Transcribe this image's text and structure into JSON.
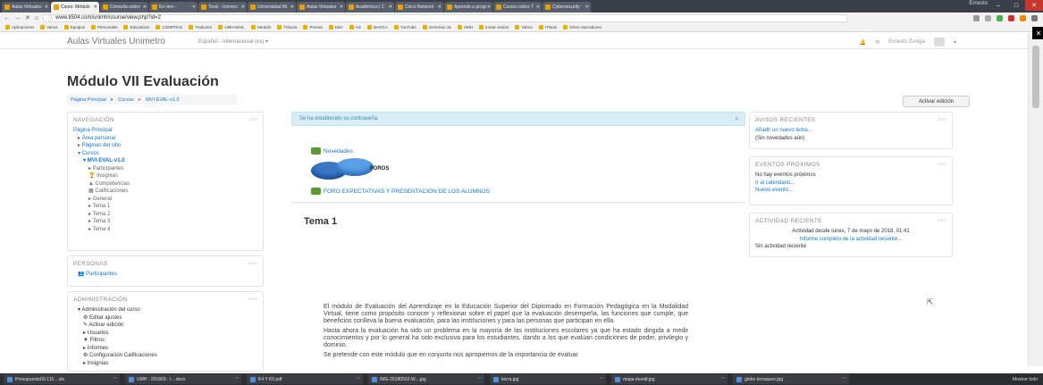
{
  "browser": {
    "tabs": [
      {
        "label": "Aulas Virtuales",
        "active": false
      },
      {
        "label": "Curso: Módulo",
        "active": true
      },
      {
        "label": "Consulta sobre",
        "active": false
      },
      {
        "label": "En vivo - ",
        "active": false
      },
      {
        "label": "Tesis - Univers",
        "active": false
      },
      {
        "label": "Universidad Mi",
        "active": false
      },
      {
        "label": "Aulas Virtuales",
        "active": false
      },
      {
        "label": "Académica | C",
        "active": false
      },
      {
        "label": "Cisco Network",
        "active": false
      },
      {
        "label": "Aprende a progr",
        "active": false
      },
      {
        "label": "Cursos sobre T",
        "active": false
      },
      {
        "label": "Cybersecurity",
        "active": false
      }
    ],
    "window_user": "Ernesto",
    "url": "www.ti504.com/unimh/course/view.php?id=2",
    "bookmarks": [
      "Aplicaciones",
      "Varios",
      "Equipos",
      "Personales",
      "Educativos",
      "COMPRAS",
      "Traductor",
      "UMH-MAIL",
      "Heraldo",
      "Tribuna",
      "Prensa",
      "Diez",
      "AS",
      "MARCA",
      "YouTube",
      "GeneXus 15",
      "UMH",
      "Iniciar sesión",
      "Yahoo",
      "ITNow",
      "Otros marcadores"
    ]
  },
  "header": {
    "site_name": "Aulas Virtuales Unimetro",
    "language": "Español - Internacional (es) ▾",
    "user_name": "Ernesto Zuniga"
  },
  "page": {
    "title": "Módulo VII Evaluación",
    "breadcrumb": [
      "Página Principal",
      "Cursos",
      "MVI-EVAL-v1.0"
    ],
    "edit_button": "Activar edición"
  },
  "nav_block": {
    "title": "NAVEGACIÓN",
    "items": [
      {
        "label": "Página Principal",
        "level": 0
      },
      {
        "label": "Área personal",
        "level": 1
      },
      {
        "label": "Páginas del sitio",
        "level": 1
      },
      {
        "label": "Cursos",
        "level": 1
      },
      {
        "label": "MVI-EVAL-v1.0",
        "level": 2
      },
      {
        "label": "Participantes",
        "level": 3
      },
      {
        "label": "Insignias",
        "level": 3
      },
      {
        "label": "Competencias",
        "level": 3
      },
      {
        "label": "Calificaciones",
        "level": 3
      },
      {
        "label": "General",
        "level": 3
      },
      {
        "label": "Tema 1",
        "level": 3
      },
      {
        "label": "Tema 2",
        "level": 3
      },
      {
        "label": "Tema 3",
        "level": 3
      },
      {
        "label": "Tema 4",
        "level": 3
      }
    ]
  },
  "people_block": {
    "title": "PERSONAS",
    "participants": "Participantes"
  },
  "admin_block": {
    "title": "ADMINISTRACIÓN",
    "items": [
      "Administración del curso",
      "Editar ajustes",
      "Activar edición",
      "Usuarios",
      "Filtros",
      "Informes",
      "Configuración Calificaciones",
      "Insignias"
    ]
  },
  "alert": "Se ha establecido su contraseña.",
  "activities": {
    "news": "Novedades",
    "foros": "FOROS",
    "forum_link": "FORO EXPECTATIVAS Y PRESENTACION DE LOS ALUMNOS"
  },
  "section": {
    "title": "Tema 1",
    "paragraphs": [
      "El módulo de Evaluación del Aprendizaje en la Educación Superior del Diplomado en Formación Pedagógica en la Modalidad Virtual, tiene como propósito conocer y reflexionar sobre el papel que la evaluación desempeña, las funciones que cumple, que beneficios conlleva la buena evaluación, para las instituciones y para las personas que participan en ella.",
      "Hasta ahora la evaluación ha sido un problema en la mayoría de las instituciones escolares ya que ha estado dirigida a medir conocimientos y por lo general ha sido exclusiva para los estudiantes, dando a los que evalúan condiciones de poder, privilegio y dominio.",
      "Se pretende con este módulo que en conjunto nos apropiemos de la importancia de evaluar"
    ]
  },
  "news_block": {
    "title": "AVISOS RECIENTES",
    "add": "Añadir un nuevo tema...",
    "empty": "(Sin novedades aún)"
  },
  "events_block": {
    "title": "EVENTOS PRÓXIMOS",
    "empty": "No hay eventos próximos",
    "calendar": "Ir al calendario...",
    "new": "Nuevo evento..."
  },
  "activity_block": {
    "title": "ACTIVIDAD RECIENTE",
    "since": "Actividad desde lunes, 7 de mayo de 2018, 01:41",
    "report": "Informe completo de la actividad reciente...",
    "empty": "Sin actividad reciente"
  },
  "taskbar": {
    "items": [
      "Presupuesto03-115....xls",
      "UMH - 201803 - I....docx",
      "K4 Y K5.pdf",
      "IMG-20180502-W....jpg",
      "tierra.jpg",
      "mapa mundi.jpg",
      "globo terraqueo.jpg"
    ],
    "show_all": "Mostrar todo"
  },
  "colors": {
    "link": "#1177d1",
    "alert_bg": "#d9edf7",
    "alert_text": "#3a87ad"
  }
}
